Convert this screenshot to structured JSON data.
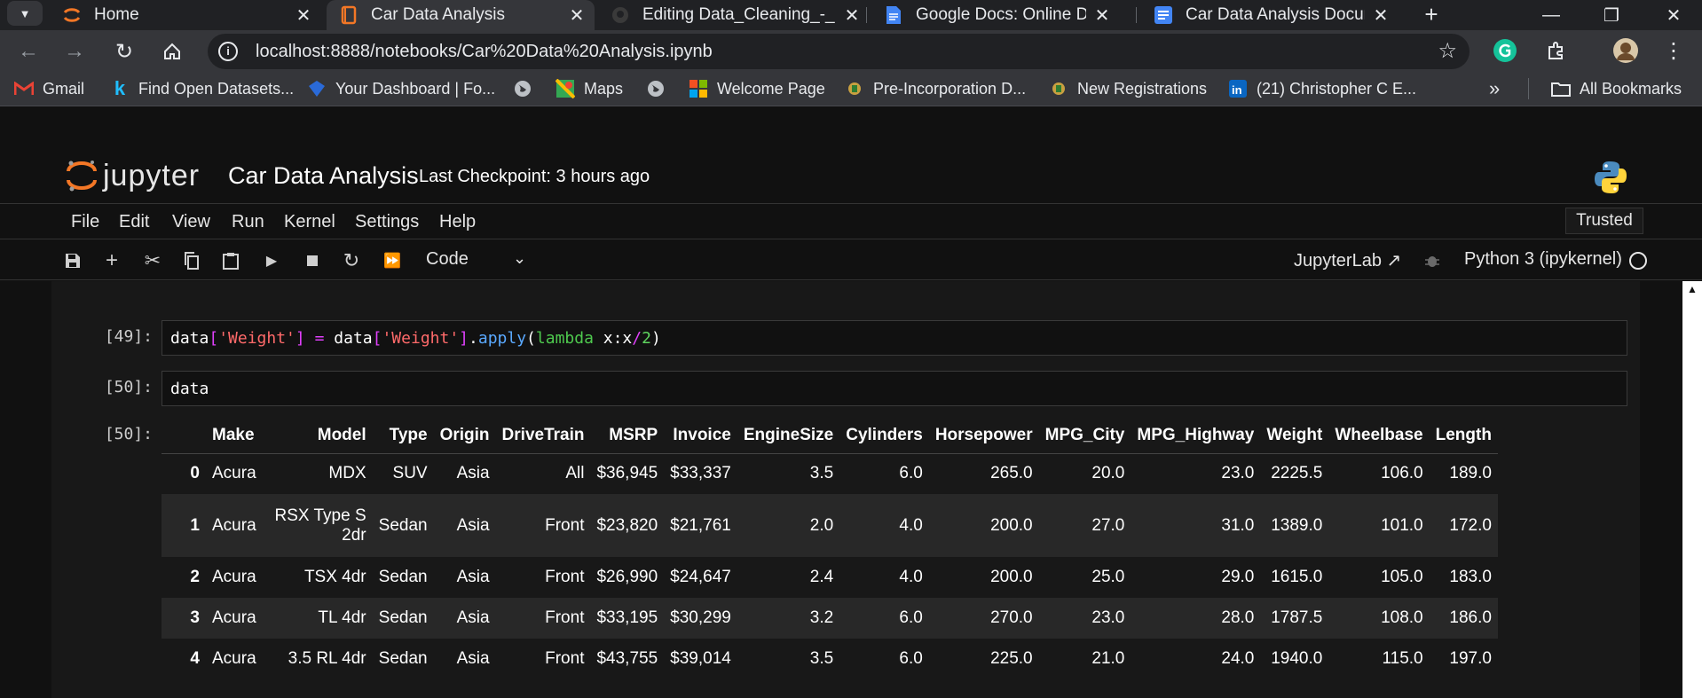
{
  "browser": {
    "tabs": [
      {
        "title": "Home",
        "icon": "jupyter-icon",
        "active": false
      },
      {
        "title": "Car Data Analysis",
        "icon": "notebook-icon",
        "active": true
      },
      {
        "title": "Editing Data_Cleaning_-_I",
        "icon": "github-icon",
        "active": false
      },
      {
        "title": "Google Docs: Online Doc",
        "icon": "google-docs-icon",
        "active": false
      },
      {
        "title": "Car Data Analysis Docum",
        "icon": "google-docs-icon",
        "active": false
      }
    ],
    "url": "localhost:8888/notebooks/Car%20Data%20Analysis.ipynb",
    "bookmarks": [
      {
        "label": "Gmail",
        "icon": "gmail-icon"
      },
      {
        "label": "Find Open Datasets...",
        "icon": "kaggle-icon"
      },
      {
        "label": "Your Dashboard | Fo...",
        "icon": "dashboard-icon"
      },
      {
        "label": "",
        "icon": "globe-icon"
      },
      {
        "label": "Maps",
        "icon": "maps-icon"
      },
      {
        "label": "",
        "icon": "globe-icon"
      },
      {
        "label": "Welcome Page",
        "icon": "microsoft-icon"
      },
      {
        "label": "Pre-Incorporation D...",
        "icon": "crest-icon"
      },
      {
        "label": "New Registrations",
        "icon": "crest-icon"
      },
      {
        "label": "(21) Christopher C E...",
        "icon": "linkedin-icon"
      }
    ],
    "all_bookmarks": "All Bookmarks"
  },
  "jupyter": {
    "logo_text": "jupyter",
    "notebook_title": "Car Data Analysis",
    "checkpoint": "Last Checkpoint: 3 hours ago",
    "menus": [
      "File",
      "Edit",
      "View",
      "Run",
      "Kernel",
      "Settings",
      "Help"
    ],
    "trusted": "Trusted",
    "cell_type": "Code",
    "jupyterlab_link": "JupyterLab",
    "kernel_name": "Python 3 (ipykernel)"
  },
  "cells": [
    {
      "prompt": "[49]:",
      "code": "data['Weight'] = data['Weight'].apply(lambda x:x/2)"
    },
    {
      "prompt": "[50]:",
      "code": "data"
    }
  ],
  "output": {
    "prompt": "[50]:",
    "columns": [
      "Make",
      "Model",
      "Type",
      "Origin",
      "DriveTrain",
      "MSRP",
      "Invoice",
      "EngineSize",
      "Cylinders",
      "Horsepower",
      "MPG_City",
      "MPG_Highway",
      "Weight",
      "Wheelbase",
      "Length"
    ],
    "rows": [
      {
        "index": "0",
        "cells": [
          "Acura",
          "MDX",
          "SUV",
          "Asia",
          "All",
          "$36,945",
          "$33,337",
          "3.5",
          "6.0",
          "265.0",
          "20.0",
          "23.0",
          "2225.5",
          "106.0",
          "189.0"
        ]
      },
      {
        "index": "1",
        "cells": [
          "Acura",
          "RSX Type S 2dr",
          "Sedan",
          "Asia",
          "Front",
          "$23,820",
          "$21,761",
          "2.0",
          "4.0",
          "200.0",
          "27.0",
          "31.0",
          "1389.0",
          "101.0",
          "172.0"
        ]
      },
      {
        "index": "2",
        "cells": [
          "Acura",
          "TSX 4dr",
          "Sedan",
          "Asia",
          "Front",
          "$26,990",
          "$24,647",
          "2.4",
          "4.0",
          "200.0",
          "25.0",
          "29.0",
          "1615.0",
          "105.0",
          "183.0"
        ]
      },
      {
        "index": "3",
        "cells": [
          "Acura",
          "TL 4dr",
          "Sedan",
          "Asia",
          "Front",
          "$33,195",
          "$30,299",
          "3.2",
          "6.0",
          "270.0",
          "23.0",
          "28.0",
          "1787.5",
          "108.0",
          "186.0"
        ]
      },
      {
        "index": "4",
        "cells": [
          "Acura",
          "3.5 RL 4dr",
          "Sedan",
          "Asia",
          "Front",
          "$43,755",
          "$39,014",
          "3.5",
          "6.0",
          "225.0",
          "21.0",
          "24.0",
          "1940.0",
          "115.0",
          "197.0"
        ]
      }
    ]
  },
  "colors": {
    "jupyter_orange": "#f37726",
    "string": "#ff6a6a",
    "keyword": "#4ec94e",
    "function": "#5aa9ff",
    "operator": "#e040fb"
  }
}
